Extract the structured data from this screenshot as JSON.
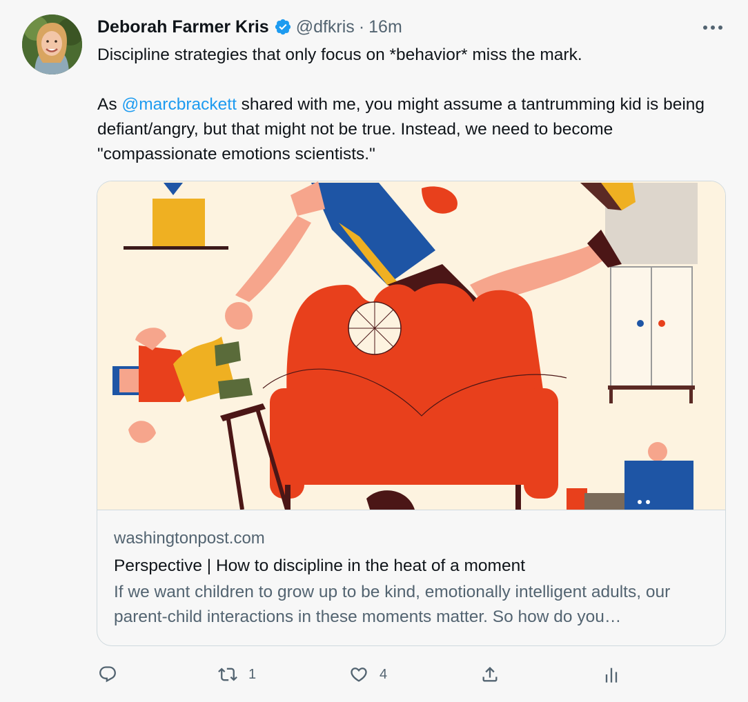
{
  "tweet": {
    "author_name": "Deborah Farmer Kris",
    "handle": "@dfkris",
    "separator": "·",
    "time": "16m",
    "text_line1": "Discipline strategies that only focus on *behavior* miss the mark.",
    "text_p2_before": "As ",
    "mention": "@marcbrackett",
    "text_p2_after": " shared with me, you might assume a tantrumming kid is being defiant/angry, but that might not be true. Instead, we need to become \"compassionate emotions scientists.\""
  },
  "card": {
    "domain": "washingtonpost.com",
    "title": "Perspective | How to discipline in the heat of a moment",
    "description": "If we want children to grow up to be kind, emotionally intelligent adults, our parent-child interactions in these moments matter. So how do you…"
  },
  "actions": {
    "reply_count": "",
    "retweet_count": "1",
    "like_count": "4"
  },
  "icons": {
    "verified": "verified-badge-icon",
    "more": "more-horizontal-icon",
    "reply": "reply-icon",
    "retweet": "retweet-icon",
    "like": "heart-icon",
    "share": "share-icon",
    "analytics": "analytics-icon"
  },
  "colors": {
    "link": "#1d9bf0",
    "secondary_text": "#536471",
    "primary_text": "#0f1419",
    "background": "#f7f7f7"
  }
}
